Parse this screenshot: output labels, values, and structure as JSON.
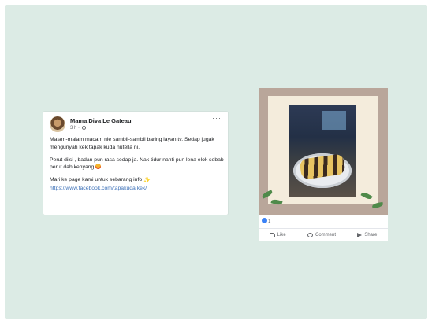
{
  "post": {
    "author": "Mama Diva Le Gateau",
    "time": "3 h ·",
    "more": "···",
    "paragraphs": [
      "Malam-malam macam nie sambil-sambil baring layan tv. Sedap jugak mengunyah kek tapak kuda nutella ni.",
      "Perut diisi , badan pun rasa sedap ja. Nak tidur nanti pun lena elok sebab perut dah kenyang"
    ],
    "cta": "Mari ke page kami untuk sebarang info",
    "link": "https://www.facebook.com/tapakuda.kek/"
  },
  "image_post": {
    "reaction_count": "1",
    "actions": {
      "like": "Like",
      "comment": "Comment",
      "share": "Share"
    }
  },
  "colors": {
    "canvas": "#dcebe5",
    "link": "#3a6fb7",
    "frame": "#b9a69a"
  }
}
